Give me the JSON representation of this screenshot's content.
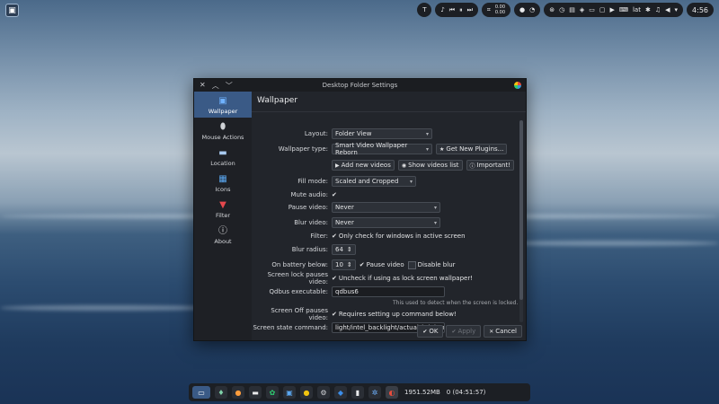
{
  "panel": {
    "cpu_top": "0.00",
    "cpu_bottom": "0.00",
    "keyboard_layout": "lat",
    "clock": "4:56",
    "media_icons": [
      "music-note-icon",
      "skip-back-icon",
      "pause-icon",
      "skip-forward-icon"
    ]
  },
  "dialog": {
    "title": "Desktop Folder Settings",
    "page_title": "Wallpaper"
  },
  "sidebar": {
    "items": [
      {
        "label": "Wallpaper",
        "icon": "wallpaper-icon"
      },
      {
        "label": "Mouse Actions",
        "icon": "mouse-icon"
      },
      {
        "label": "Location",
        "icon": "folder-icon"
      },
      {
        "label": "Icons",
        "icon": "grid-icon"
      },
      {
        "label": "Filter",
        "icon": "funnel-icon"
      },
      {
        "label": "About",
        "icon": "info-icon"
      }
    ]
  },
  "form": {
    "layout_label": "Layout:",
    "layout_value": "Folder View",
    "wallpaper_type_label": "Wallpaper type:",
    "wallpaper_type_value": "Smart Video Wallpaper Reborn",
    "get_plugins": "Get New Plugins...",
    "add_videos": "Add new videos",
    "show_videos": "Show videos list",
    "important": "Important!",
    "fill_mode_label": "Fill mode:",
    "fill_mode_value": "Scaled and Cropped",
    "mute_label": "Mute audio:",
    "pause_label": "Pause video:",
    "pause_value": "Never",
    "blur_label": "Blur video:",
    "blur_value": "Never",
    "filter_label": "Filter:",
    "filter_text": "Only check for windows in active screen",
    "blur_radius_label": "Blur radius:",
    "blur_radius_value": "64",
    "battery_label": "On battery below:",
    "battery_value": "10",
    "pause_video_check": "Pause video",
    "disable_blur_check": "Disable blur",
    "lock_label": "Screen lock pauses video:",
    "lock_text": "Uncheck if using as lock screen wallpaper!",
    "qdbus_label": "Qdbus executable:",
    "qdbus_value": "qdbus6",
    "qdbus_hint": "This used to detect when the screen is locked.",
    "screenoff_label": "Screen Off pauses video:",
    "screenoff_text": "Requires setting up command below!",
    "state_cmd_label": "Screen state command:",
    "state_cmd_value": "light/intel_backlight/actual_brightness"
  },
  "footer": {
    "ok": "OK",
    "apply": "Apply",
    "cancel": "Cancel"
  },
  "taskbar": {
    "memory": "1951.52MB",
    "uptime": "0 (04:51:57)"
  }
}
